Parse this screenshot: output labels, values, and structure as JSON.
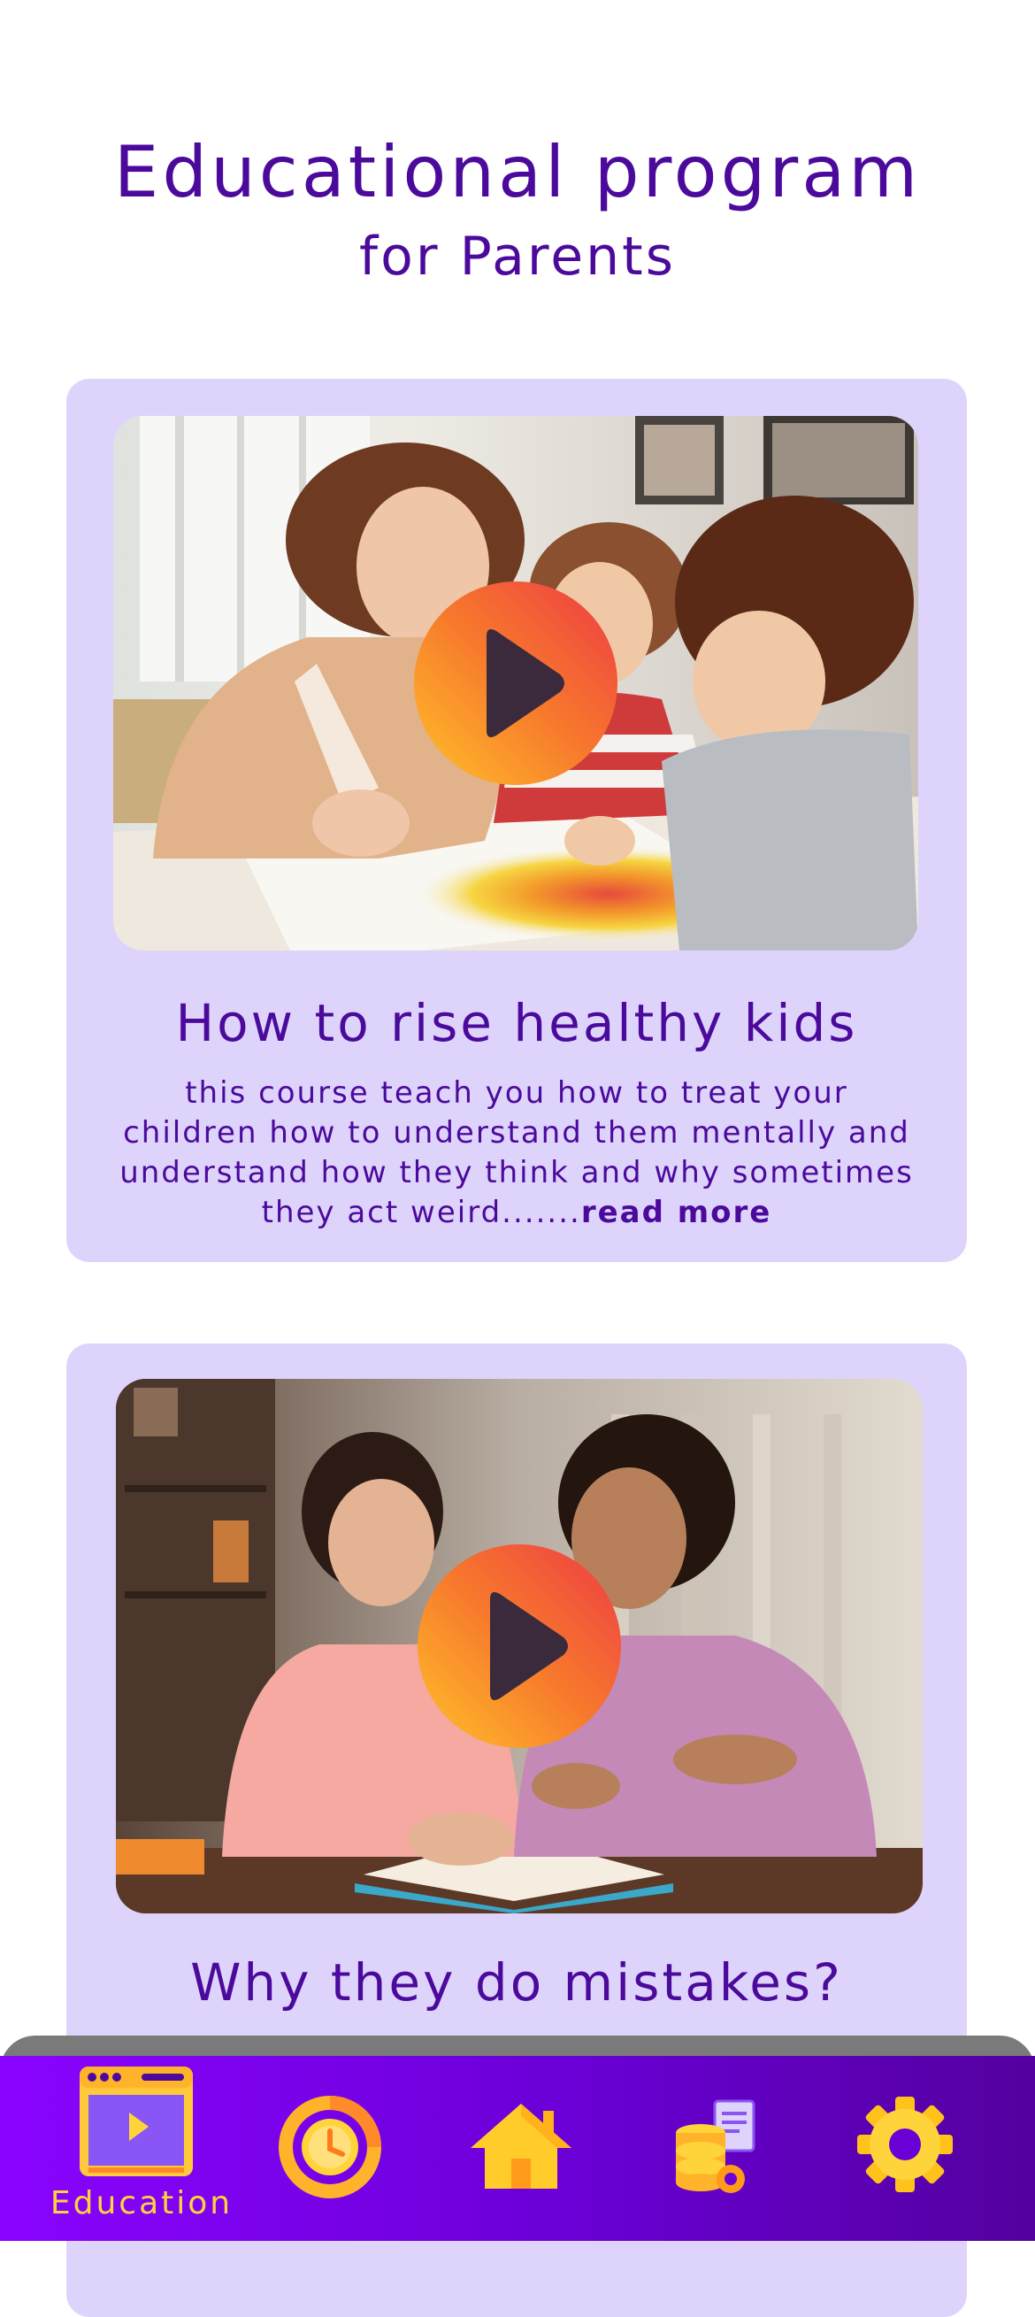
{
  "header": {
    "title": "Educational program",
    "subtitle": "for Parents"
  },
  "courses": [
    {
      "title": "How to rise healthy kids",
      "description": "this course teach you how to treat your children how to understand them mentally and understand how they think and why sometimes they act weird.......",
      "read_more": "read more",
      "media_icon": "video-thumbnail"
    },
    {
      "title": "Why they do mistakes?",
      "media_icon": "video-thumbnail"
    }
  ],
  "bottom_nav": {
    "items": [
      {
        "label": "Education",
        "icon": "video-player-icon",
        "active": true
      },
      {
        "icon": "progress-clock-icon"
      },
      {
        "icon": "home-icon"
      },
      {
        "icon": "database-settings-icon"
      },
      {
        "icon": "gear-icon"
      }
    ]
  },
  "colors": {
    "text": "#4b0a9c",
    "card_background": "#ded4fb",
    "nav_background": "#7b00f0",
    "nav_accent": "#ffd43a",
    "play_gradient_start": "#ffc12a",
    "play_gradient_end": "#ee3b45"
  }
}
